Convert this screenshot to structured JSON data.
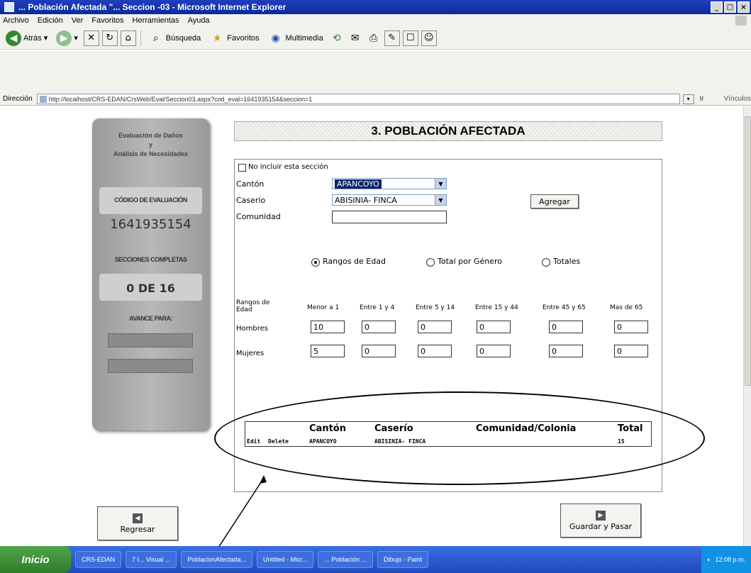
{
  "window": {
    "title": "... Población Afectada \"... Seccion -03 - Microsoft Internet Explorer"
  },
  "menu": [
    "Archivo",
    "Edición",
    "Ver",
    "Favoritos",
    "Herramientas",
    "Ayuda"
  ],
  "toolbar": {
    "back": "Atrás",
    "search": "Búsqueda",
    "favorites": "Favoritos",
    "multimedia": "Multimedia"
  },
  "address": {
    "label": "Dirección",
    "url": "http://localhost/CRS-EDAN/CrsWeb/Eval/Seccion03.aspx?cod_eval=1641935154&seccion=1",
    "go": "Ir",
    "links": "Vínculos"
  },
  "sidebar": {
    "title_line1": "Evaluación de Daños",
    "title_line2": "y",
    "title_line3": "Análisis de Necesidades",
    "code_label": "CÓDIGO DE EVALUACIÓN",
    "code_value": "1641935154",
    "sections_label": "SECCIONES COMPLETAS",
    "sections_value": "0 DE 16",
    "advance_label": "AVANCE PARA:"
  },
  "header": {
    "title": "3. POBLACIÓN AFECTADA"
  },
  "form": {
    "exclude_label": "No incluir esta sección",
    "canton_label": "Cantón",
    "canton_value": "APANCOYO",
    "caserio_label": "Caserío",
    "caserio_value": "ABISINIA- FINCA",
    "comunidad_label": "Comunidad",
    "comunidad_value": "",
    "add_button": "Agregar",
    "radio_rangos": "Rangos de Edad",
    "radio_genero": "Total por Género",
    "radio_totales": "Totales",
    "rangos_label_line1": "Rangos de",
    "rangos_label_line2": "Edad",
    "age_columns": [
      "Menor a 1",
      "Entre 1 y 4",
      "Entre 5 y 14",
      "Entre 15 y 44",
      "Entre 45 y 65",
      "Mas de 65"
    ],
    "hombres_label": "Hombres",
    "mujeres_label": "Mujeres",
    "hombres_values": [
      "10",
      "0",
      "0",
      "0",
      "0",
      "0"
    ],
    "mujeres_values": [
      "5",
      "0",
      "0",
      "0",
      "0",
      "0"
    ]
  },
  "summary": {
    "headers": [
      "Cantón",
      "Caserío",
      "Comunidad/Colonia",
      "Total"
    ],
    "row": {
      "edit": "Edit",
      "delete": "Delete",
      "canton": "APANCOYO",
      "caserio": "ABISINIA- FINCA",
      "comunidad": "",
      "total": "15"
    }
  },
  "nav": {
    "back": "Regresar",
    "save": "Guardar y Pasar"
  },
  "taskbar": {
    "start": "Inicio",
    "tasks": [
      "CRS-EDAN",
      "7 I... Visual ...",
      "PoblacionAfectada...",
      "Untitled - Micr...",
      "... Población ...",
      "Dibujo - Paint"
    ],
    "clock": "12:08 p.m."
  }
}
